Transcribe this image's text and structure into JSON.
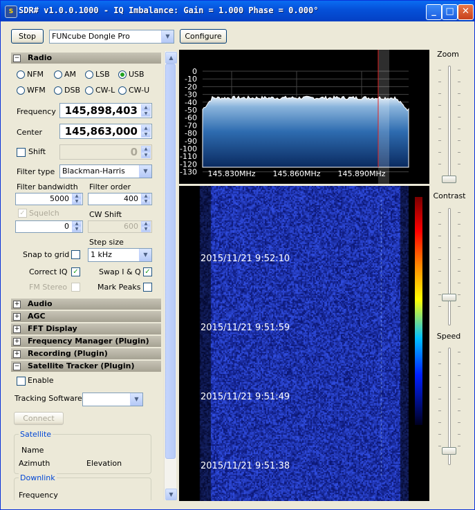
{
  "window": {
    "title": "SDR# v1.0.0.1000 - IQ Imbalance: Gain = 1.000 Phase = 0.000°"
  },
  "toolbar": {
    "stop_label": "Stop",
    "device": "FUNcube Dongle Pro",
    "configure_label": "Configure"
  },
  "radio": {
    "header": "Radio",
    "modes": [
      "NFM",
      "AM",
      "LSB",
      "USB",
      "WFM",
      "DSB",
      "CW-L",
      "CW-U"
    ],
    "selected_mode": "USB",
    "frequency_label": "Frequency",
    "frequency": "145,898,403",
    "center_label": "Center",
    "center": "145,863,000",
    "shift_label": "Shift",
    "shift": "0",
    "filter_type_label": "Filter type",
    "filter_type": "Blackman-Harris",
    "filter_bandwidth_label": "Filter bandwidth",
    "filter_bandwidth": "5000",
    "filter_order_label": "Filter order",
    "filter_order": "400",
    "squelch_label": "Squelch",
    "squelch": "0",
    "cw_shift_label": "CW Shift",
    "cw_shift": "600",
    "step_size_label": "Step size",
    "step_size": "1 kHz",
    "snap_label": "Snap to grid",
    "correct_iq_label": "Correct IQ",
    "swap_iq_label": "Swap I & Q",
    "fm_stereo_label": "FM Stereo",
    "mark_peaks_label": "Mark Peaks"
  },
  "sections": [
    "Audio",
    "AGC",
    "FFT Display",
    "Frequency Manager (Plugin)",
    "Recording (Plugin)"
  ],
  "satellite_tracker": {
    "header": "Satellite Tracker (Plugin)",
    "enable_label": "Enable",
    "tracking_software_label": "Tracking Software",
    "tracking_software": "",
    "connect_label": "Connect",
    "satellite_group": "Satellite",
    "name_label": "Name",
    "azimuth_label": "Azimuth",
    "elevation_label": "Elevation",
    "downlink_group": "Downlink",
    "frequency_label": "Frequency"
  },
  "spectrum": {
    "db_labels": [
      "0",
      "-10",
      "-20",
      "-30",
      "-40",
      "-50",
      "-60",
      "-70",
      "-80",
      "-90",
      "-100",
      "-110",
      "-120",
      "-130"
    ],
    "freq_labels": [
      "145.830MHz",
      "145.860MHz",
      "145.890MHz"
    ],
    "accent": "#3a78b8"
  },
  "waterfall": {
    "timestamps": [
      "2015/11/21 9:52:10",
      "2015/11/21 9:51:59",
      "2015/11/21 9:51:49",
      "2015/11/21 9:51:38"
    ]
  },
  "sliders": {
    "zoom_label": "Zoom",
    "contrast_label": "Contrast",
    "speed_label": "Speed"
  }
}
